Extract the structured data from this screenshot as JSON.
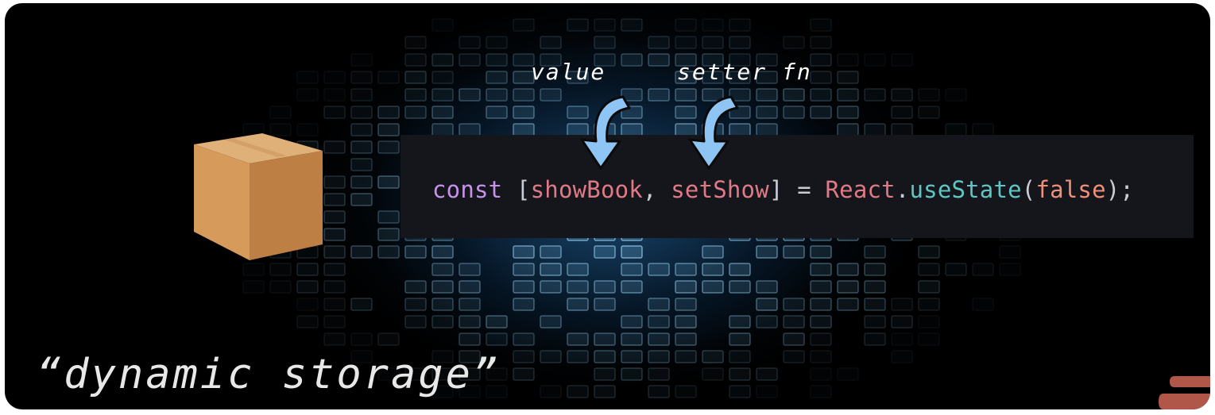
{
  "scene": {
    "annotations": {
      "value_label": "value",
      "setter_label": "setter fn"
    },
    "code": {
      "keyword": "const",
      "open_bracket": " [",
      "state_var": "showBook",
      "comma": ", ",
      "setter_var": "setShow",
      "close_assign": "] = ",
      "object": "React",
      "dot": ".",
      "method": "useState",
      "open_paren": "(",
      "initial_value": "false",
      "close": ");"
    },
    "caption": "“dynamic storage”",
    "icons": [
      "cardboard-box-icon",
      "curved-arrow-down-icon",
      "corner-logo-icon"
    ],
    "colors": {
      "keyword": "#c792ea",
      "variable": "#e07a86",
      "method": "#5fc6c3",
      "boolean": "#f08f7a",
      "arrow_fill": "#8ec5f5",
      "box": "#c68a4e"
    }
  }
}
